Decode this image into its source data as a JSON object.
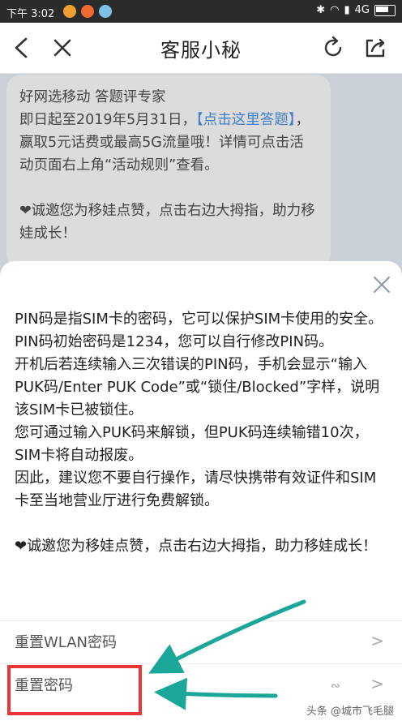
{
  "status_bar": {
    "time": "下午 3:02",
    "network": "4G"
  },
  "header": {
    "title": "客服小秘"
  },
  "bubble": {
    "line1": "好网选移动 答题评专家",
    "line2_pre": "即日起至2019年5月31日，",
    "link": "【点击这里答题】",
    "line2_post": "，赢取5元话费或最高5G流量哦！详情可点击活动页面右上角“活动规则”查看。",
    "invite": "❤诚邀您为移娃点赞，点击右边大拇指，助力移娃成长！"
  },
  "sheet": {
    "paragraphs": [
      "PIN码是指SIM卡的密码，它可以保护SIM卡使用的安全。",
      "PIN码初始密码是1234，您可以自行修改PIN码。",
      "开机后若连续输入三次错误的PIN码，手机会显示“输入PUK码/Enter PUK Code”或“锁住/Blocked”字样，说明该SIM卡已被锁住。",
      "您可通过输入PUK码来解锁，但PUK码连续输错10次，SIM卡将自动报废。",
      "因此，建议您不要自行操作，请尽快携带有效证件和SIM卡至当地营业厅进行免费解锁。"
    ],
    "invite": "❤诚邀您为移娃点赞，点击右边大拇指，助力移娃成长！",
    "menu": [
      {
        "label": "重置WLAN密码"
      },
      {
        "label": "重置密码"
      }
    ]
  },
  "watermark": "头条 @城市飞毛腿",
  "colors": {
    "link": "#3f7fc9",
    "annotation_red": "#ea3535",
    "annotation_arrow": "#1aa79a"
  }
}
